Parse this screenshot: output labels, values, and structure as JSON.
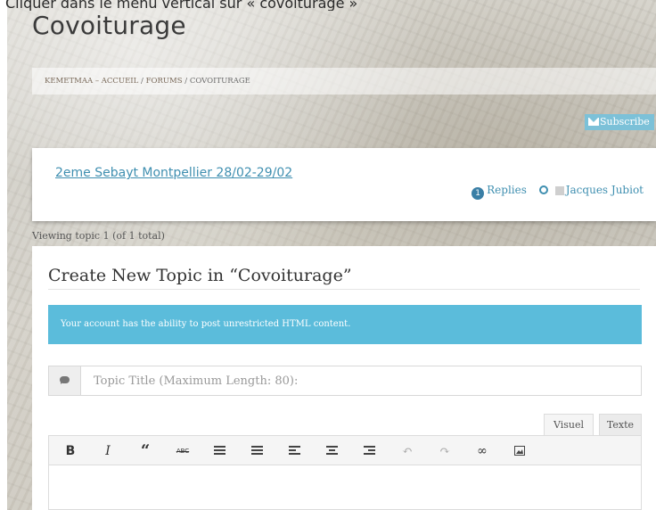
{
  "instruction": "Cliquer dans le menu vertical sur « covoiturage »",
  "page_title": "Covoiturage",
  "breadcrumb": {
    "home": "KEMETMAA – ACCUEIL",
    "sep1": "/",
    "forums": "FORUMS",
    "sep2": "/",
    "current": "COVOITURAGE"
  },
  "subscribe_label": "Subscribe",
  "topic": {
    "title": "2eme Sebayt Montpellier 28/02-29/02",
    "reply_count": "1",
    "replies_label": "Replies",
    "author": "Jacques Jubiot"
  },
  "viewing_text": "Viewing topic 1 (of 1 total)",
  "form": {
    "title": "Create New Topic in “Covoiturage”",
    "alert": "Your account has the ability to post unrestricted HTML content.",
    "topic_title_placeholder": "Topic Title (Maximum Length: 80):",
    "tab_visual": "Visuel",
    "tab_text": "Texte"
  },
  "toolbar_icons": [
    "bold-icon",
    "italic-icon",
    "blockquote-icon",
    "strikethrough-icon",
    "bullet-list-icon",
    "numbered-list-icon",
    "align-left-icon",
    "align-center-icon",
    "align-right-icon",
    "undo-icon",
    "redo-icon",
    "link-icon",
    "image-icon"
  ],
  "colors": {
    "accent": "#3f8fb0",
    "alert_bg": "#5bbcdb",
    "subscribe_bg": "#7cc1d8"
  }
}
